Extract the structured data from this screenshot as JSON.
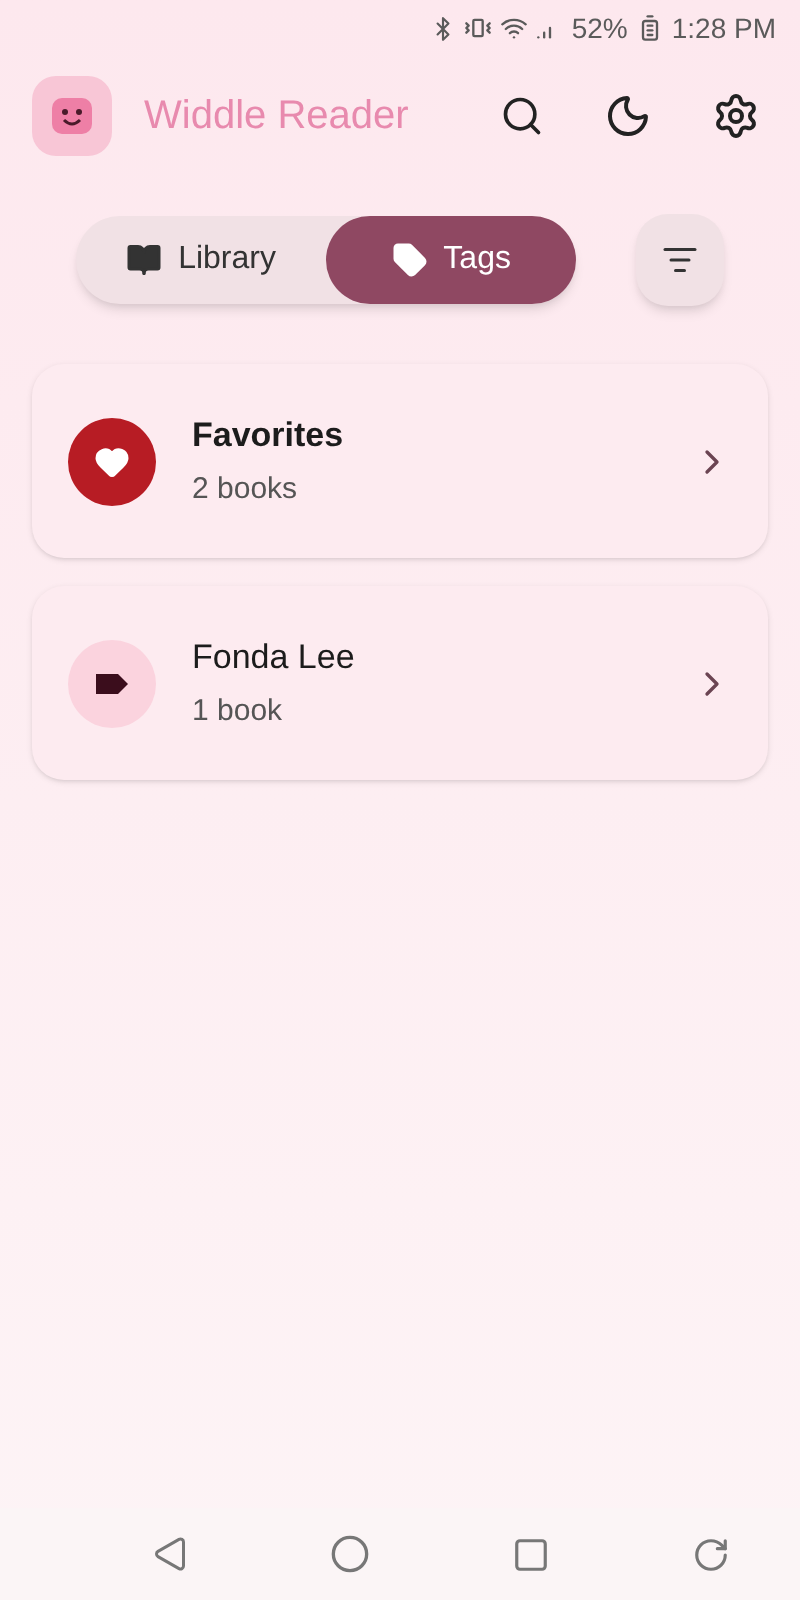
{
  "status_bar": {
    "battery": "52%",
    "time": "1:28 PM"
  },
  "app_bar": {
    "title": "Widdle Reader"
  },
  "tabs": [
    {
      "kind": "library",
      "label": "Library",
      "selected": false
    },
    {
      "kind": "tags",
      "label": "Tags",
      "selected": true
    }
  ],
  "tags": [
    {
      "kind": "favorite",
      "name": "Favorites",
      "count": "2 books"
    },
    {
      "kind": "tag",
      "name": "Fonda Lee",
      "count": "1 book"
    }
  ]
}
